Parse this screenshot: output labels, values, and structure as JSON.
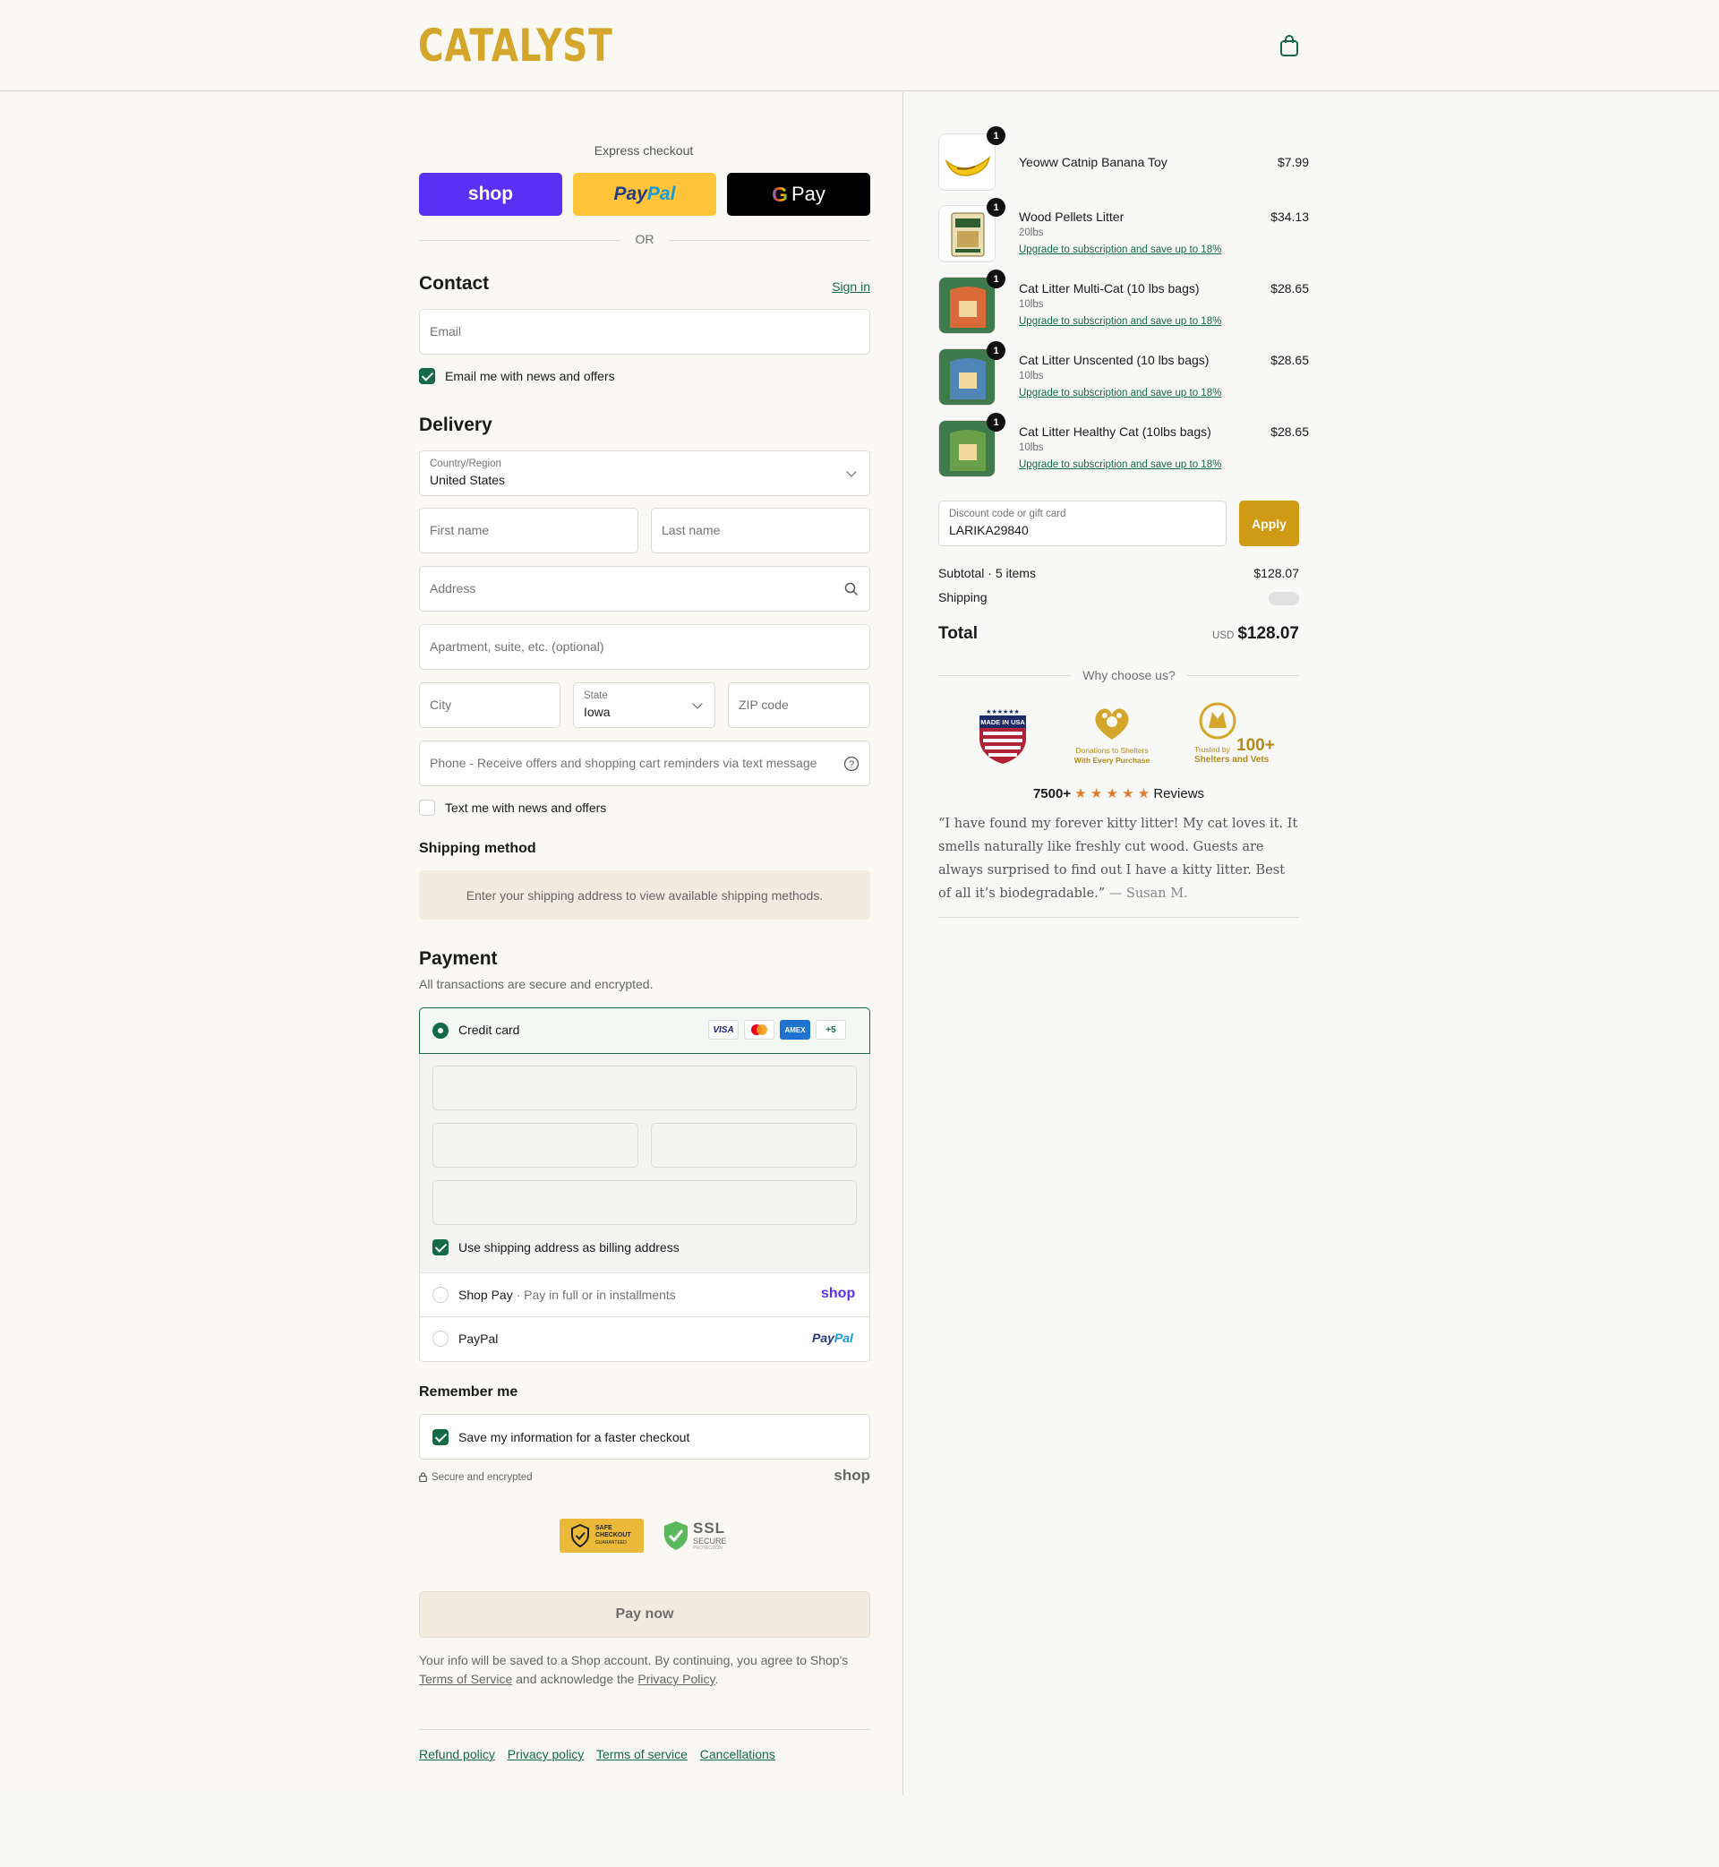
{
  "header": {
    "logo": "CATALYST",
    "cart_icon": "shopping-bag-icon"
  },
  "express": {
    "title": "Express checkout",
    "shop_label": "shop",
    "paypal_label_1": "Pay",
    "paypal_label_2": "Pal",
    "gpay_label": "Pay",
    "or": "OR"
  },
  "contact": {
    "title": "Contact",
    "sign_in": "Sign in",
    "email_placeholder": "Email",
    "news_label": "Email me with news and offers",
    "news_checked": true
  },
  "delivery": {
    "title": "Delivery",
    "country_label": "Country/Region",
    "country_value": "United States",
    "first_name": "First name",
    "last_name": "Last name",
    "address": "Address",
    "apartment": "Apartment, suite, etc. (optional)",
    "city": "City",
    "state_label": "State",
    "state_value": "Iowa",
    "zip": "ZIP code",
    "phone": "Phone - Receive offers and shopping cart reminders via text message",
    "text_label": "Text me with news and offers",
    "text_checked": false
  },
  "shipping_method": {
    "title": "Shipping method",
    "notice": "Enter your shipping address to view available shipping methods."
  },
  "payment": {
    "title": "Payment",
    "subtitle": "All transactions are secure and encrypted.",
    "credit_card": "Credit card",
    "cards": [
      "VISA",
      "MC",
      "AMEX",
      "+5"
    ],
    "billing_label": "Use shipping address as billing address",
    "shop_pay": "Shop Pay",
    "shop_pay_sep": "·",
    "shop_pay_desc": "Pay in full or in installments",
    "shop_pay_logo": "shop",
    "paypal": "PayPal",
    "paypal_logo_1": "Pay",
    "paypal_logo_2": "Pal"
  },
  "remember": {
    "title": "Remember me",
    "save_label": "Save my information for a faster checkout",
    "secure": "Secure and encrypted",
    "shop_logo": "shop"
  },
  "badges": {
    "safe_1": "SAFE",
    "safe_2": "CHECKOUT",
    "safe_3": "GUARANTEED",
    "ssl_1": "SSL",
    "ssl_2": "SECURE",
    "ssl_3": "PROTECTION"
  },
  "pay_now": "Pay now",
  "legal": {
    "text_1": "Your info will be saved to a Shop account. By continuing, you agree to Shop's",
    "terms": "Terms of Service",
    "text_2": "and acknowledge the",
    "privacy": "Privacy Policy",
    "text_3": "."
  },
  "footer_links": [
    "Refund policy",
    "Privacy policy",
    "Terms of service",
    "Cancellations"
  ],
  "cart": {
    "items": [
      {
        "name": "Yeoww Catnip Banana Toy",
        "variant": "",
        "upgrade": "",
        "price": "$7.99",
        "qty": "1"
      },
      {
        "name": "Wood Pellets Litter",
        "variant": "20lbs",
        "upgrade": "Upgrade to subscription and save up to 18%",
        "price": "$34.13",
        "qty": "1"
      },
      {
        "name": "Cat Litter Multi-Cat (10 lbs bags)",
        "variant": "10lbs",
        "upgrade": "Upgrade to subscription and save up to 18%",
        "price": "$28.65",
        "qty": "1"
      },
      {
        "name": "Cat Litter Unscented (10 lbs bags)",
        "variant": "10lbs",
        "upgrade": "Upgrade to subscription and save up to 18%",
        "price": "$28.65",
        "qty": "1"
      },
      {
        "name": "Cat Litter Healthy Cat (10lbs bags)",
        "variant": "10lbs",
        "upgrade": "Upgrade to subscription and save up to 18%",
        "price": "$28.65",
        "qty": "1"
      }
    ],
    "discount_label": "Discount code or gift card",
    "discount_value": "LARIKA29840",
    "apply": "Apply",
    "subtotal_label": "Subtotal · 5 items",
    "subtotal_value": "$128.07",
    "shipping_label": "Shipping",
    "total_label": "Total",
    "currency": "USD",
    "total_value": "$128.07"
  },
  "why": {
    "title": "Why choose us?",
    "badge1": "MADE IN USA",
    "badge2_1": "Donations to Shelters",
    "badge2_2": "With Every Purchase",
    "badge3_1": "Trusted by",
    "badge3_2": "100+",
    "badge3_3": "Shelters and Vets",
    "reviews_count": "7500+",
    "stars": "★ ★ ★ ★ ★",
    "reviews_label": "Reviews",
    "quote": "“I have found my forever kitty litter! My cat loves it. It smells naturally like freshly cut wood. Guests are always surprised to find out I have a kitty litter. Best of all it’s biodegradable.”",
    "author": "— Susan M."
  },
  "colors": {
    "brand": "#d4a72c",
    "accent": "#136a44",
    "shop": "#5a31f4",
    "paypal": "#ffc439"
  }
}
